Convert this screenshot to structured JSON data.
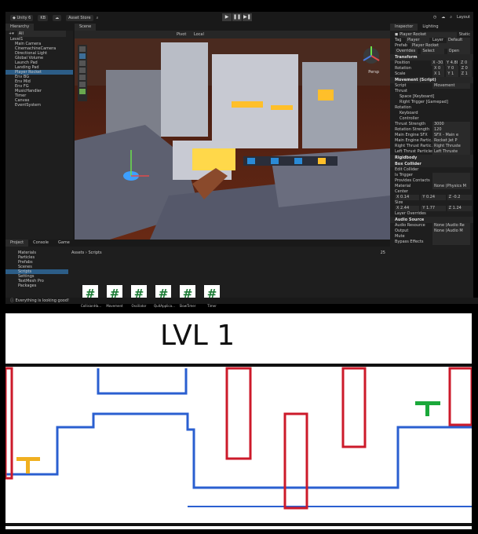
{
  "toolbar": {
    "app": "Unity 6",
    "account": "KB",
    "asset_store": "Asset Store",
    "layout": "Layout"
  },
  "hierarchy": {
    "tab": "Hierarchy",
    "search": "All",
    "items": [
      "Level1",
      "Main Camera",
      "CinemachineCamera",
      "Directional Light",
      "Global Volume",
      "Launch Pad",
      "Landing Pad",
      "Player Rocket",
      "Env BG",
      "Env Mid",
      "Env FG",
      "MusicHandler",
      "Timer",
      "Canvas",
      "EventSystem"
    ]
  },
  "scene": {
    "tab": "Scene",
    "pivot": "Pivot",
    "local": "Local",
    "persp": "Persp"
  },
  "project": {
    "tab_project": "Project",
    "tab_console": "Console",
    "tab_game": "Game",
    "folders": [
      "Materials",
      "Particles",
      "Prefabs",
      "Scenes",
      "Scripts",
      "Settings",
      "TextMesh Pro",
      "Packages"
    ],
    "breadcrumb": "Assets › Scripts",
    "files": [
      "CollisionHa...",
      "Movement",
      "Oscillator",
      "QuitApplica...",
      "SlowTimer",
      "Timer"
    ],
    "count": "25"
  },
  "inspector": {
    "tab_inspector": "Inspector",
    "tab_lighting": "Lighting",
    "object_name": "Player Rocket",
    "static": "Static",
    "tag_label": "Tag",
    "tag": "Player",
    "layer_label": "Layer",
    "layer": "Default",
    "prefab_label": "Prefab",
    "prefab": "Player Rocket",
    "overrides": "Overrides",
    "select": "Select",
    "open": "Open",
    "transform": "Transform",
    "position": [
      "X -30.2",
      "Y 4.88",
      "Z 0"
    ],
    "rotation": [
      "X 0",
      "Y 0",
      "Z 0"
    ],
    "scale": [
      "X 1",
      "Y 1",
      "Z 1"
    ],
    "movement": "Movement (Script)",
    "script_label": "Script",
    "script_value": "Movement",
    "thrust_label": "Thrust",
    "thrust_bindings": [
      "Space [Keyboard]",
      "Right Trigger [Gamepad]"
    ],
    "rotation_label": "Rotation",
    "rotation_bindings": [
      "Keyboard",
      "Controller"
    ],
    "fields": [
      {
        "label": "Thrust Strength",
        "value": "3000"
      },
      {
        "label": "Rotation Strength",
        "value": "120"
      },
      {
        "label": "Main Engine SFX",
        "value": "SFX - Main e"
      },
      {
        "label": "Main Engine Partic...",
        "value": "Rocket Jet P"
      },
      {
        "label": "Right Thrust Partic...",
        "value": "Right Thruste"
      },
      {
        "label": "Left Thrust Particles",
        "value": "Left Thruste"
      }
    ],
    "rigidbody": "Rigidbody",
    "box_collider": "Box Collider",
    "edit_collider": "Edit Collider",
    "collider_fields": [
      {
        "label": "Is Trigger",
        "value": ""
      },
      {
        "label": "Provides Contacts",
        "value": ""
      },
      {
        "label": "Material",
        "value": "None (Physics M"
      }
    ],
    "center_label": "Center",
    "center": [
      "X 0.14",
      "Y 0.24",
      "Z -0.2"
    ],
    "size_label": "Size",
    "size": [
      "X 2.44",
      "Y 1.77",
      "Z 1.24"
    ],
    "layer_overrides": "Layer Overrides",
    "audio_source": "Audio Source",
    "audio_fields": [
      {
        "label": "Audio Resource",
        "value": "None (Audio Re"
      },
      {
        "label": "Output",
        "value": "None (Audio M"
      },
      {
        "label": "Mute",
        "value": ""
      },
      {
        "label": "Bypass Effects",
        "value": ""
      }
    ]
  },
  "status": "Everything is looking good!",
  "sketch": {
    "title": "LVL 1"
  }
}
